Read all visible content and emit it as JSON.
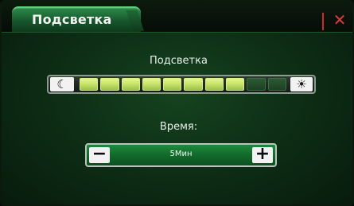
{
  "tab": {
    "title": "Подсветка"
  },
  "close": {
    "glyph": "✕"
  },
  "backlight": {
    "label": "Подсветка",
    "dim_glyph": "☾",
    "bright_glyph": "☀",
    "level": 8,
    "max": 10
  },
  "timer": {
    "label": "Время:",
    "minus_glyph": "−",
    "plus_glyph": "+",
    "value": "5Мин"
  },
  "colors": {
    "accent_green": "#1e8a3c",
    "active_segment": "#c9e56a",
    "close_red": "#e23a3a"
  }
}
